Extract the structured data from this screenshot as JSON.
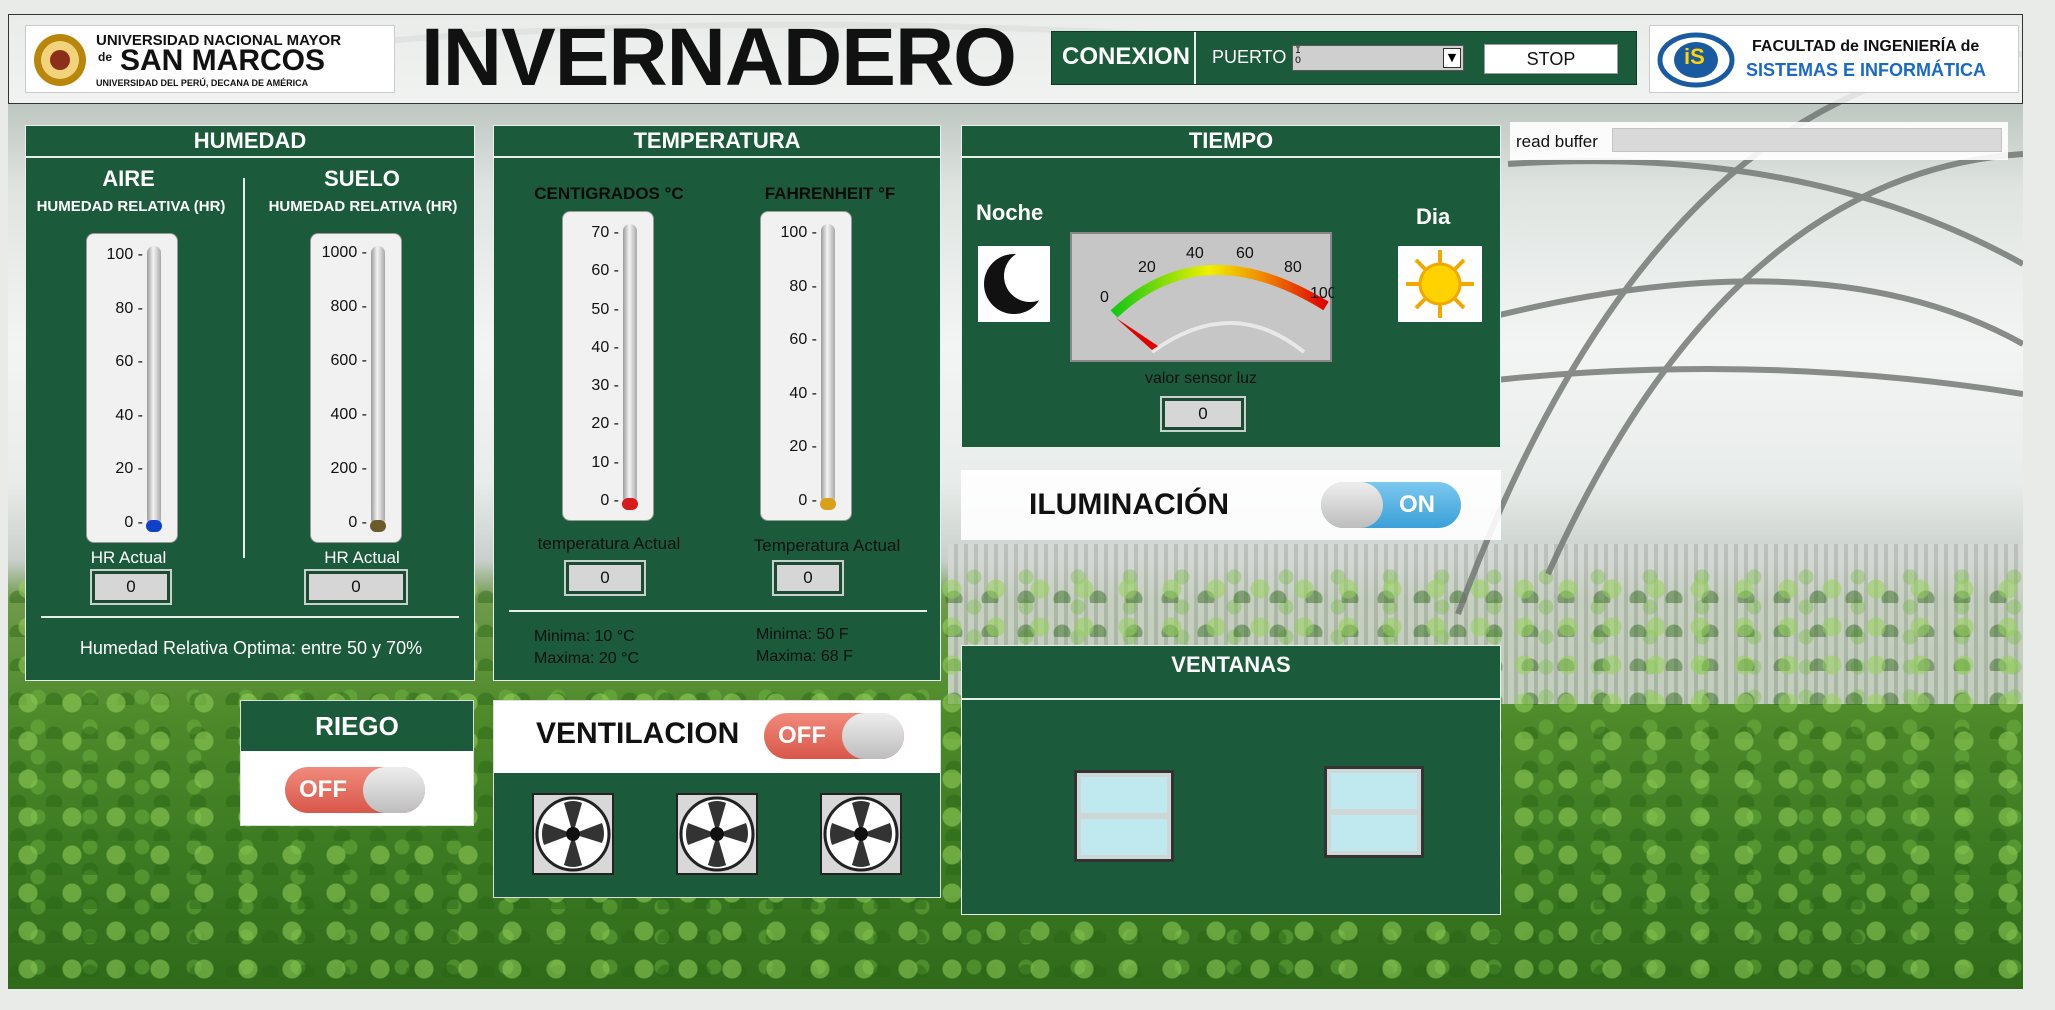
{
  "header": {
    "unmsm_line1": "UNIVERSIDAD NACIONAL MAYOR",
    "unmsm_line2_pre": "de",
    "unmsm_line2": "SAN MARCOS",
    "unmsm_line3": "UNIVERSIDAD DEL PERÚ, DECANA DE AMÉRICA",
    "title": "INVERNADERO",
    "conexion_label": "CONEXION",
    "puerto_label": "PUERTO",
    "puerto_value": "",
    "stop_label": "STOP",
    "fisi_line1": "FACULTAD de INGENIERÍA de",
    "fisi_line2": "SISTEMAS E INFORMÁTICA",
    "fisi_logo_text": "iS"
  },
  "read_buffer": {
    "label": "read buffer",
    "value": ""
  },
  "humedad": {
    "title": "HUMEDAD",
    "aire": {
      "title": "AIRE",
      "subtitle": "HUMEDAD RELATIVA (HR)",
      "ticks": [
        "100",
        "80",
        "60",
        "40",
        "20",
        "0"
      ],
      "actual_label": "HR Actual",
      "actual_value": "0",
      "level": 0,
      "bulb_color": "#1040c8"
    },
    "suelo": {
      "title": "SUELO",
      "subtitle": "HUMEDAD RELATIVA (HR)",
      "ticks": [
        "1000",
        "800",
        "600",
        "400",
        "200",
        "0"
      ],
      "actual_label": "HR Actual",
      "actual_value": "0",
      "level": 0,
      "bulb_color": "#6b5a2a"
    },
    "note": "Humedad Relativa Optima: entre 50 y 70%"
  },
  "temperatura": {
    "title": "TEMPERATURA",
    "celsius": {
      "title": "CENTIGRADOS °C",
      "ticks": [
        "70",
        "60",
        "50",
        "40",
        "30",
        "20",
        "10",
        "0"
      ],
      "actual_label": "temperatura Actual",
      "actual_value": "0",
      "min": "Minima: 10 °C",
      "max": "Maxima: 20 °C",
      "bulb_color": "#d81a1a"
    },
    "fahrenheit": {
      "title": "FAHRENHEIT °F",
      "ticks": [
        "100",
        "80",
        "60",
        "40",
        "20",
        "0"
      ],
      "actual_label": "Temperatura Actual",
      "actual_value": "0",
      "min": "Minima: 50 F",
      "max": "Maxima: 68 F",
      "bulb_color": "#d9a01a"
    }
  },
  "tiempo": {
    "title": "TIEMPO",
    "noche_label": "Noche",
    "dia_label": "Dia",
    "gauge_ticks": [
      "0",
      "20",
      "40",
      "60",
      "80",
      "100"
    ],
    "gauge_value": 0,
    "sensor_label": "valor sensor luz",
    "sensor_value": "0"
  },
  "iluminacion": {
    "label": "ILUMINACIÓN",
    "state": "ON"
  },
  "ventanas": {
    "title": "VENTANAS"
  },
  "riego": {
    "title": "RIEGO",
    "state": "OFF"
  },
  "ventilacion": {
    "title": "VENTILACION",
    "state": "OFF"
  },
  "colors": {
    "panel": "#1b5b3b",
    "off": "#d9574a",
    "on": "#3aa0d8"
  }
}
